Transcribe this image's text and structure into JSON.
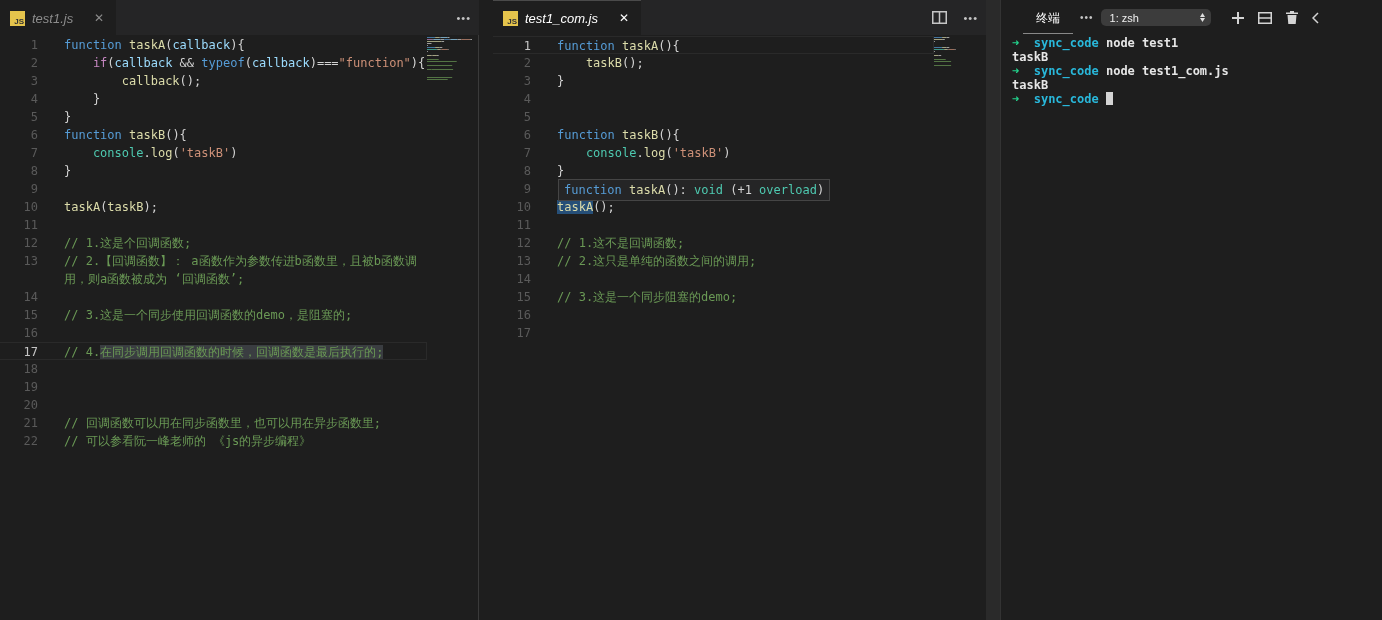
{
  "editors": [
    {
      "focused": false,
      "tab": {
        "icon_label": "JS",
        "title": "test1.js",
        "close": "✕"
      },
      "actions": [
        {
          "kind": "more",
          "label": "•••"
        }
      ],
      "lines": [
        {
          "number": "1",
          "current": false,
          "tokens": [
            {
              "kind": "kw",
              "text": "function "
            },
            {
              "kind": "fn",
              "text": "taskA"
            },
            {
              "kind": "plain",
              "text": "("
            },
            {
              "kind": "param",
              "text": "callback"
            },
            {
              "kind": "plain",
              "text": "){"
            }
          ]
        },
        {
          "number": "2",
          "current": false,
          "tokens": [
            {
              "kind": "ctrl",
              "text": "    if"
            },
            {
              "kind": "plain",
              "text": "("
            },
            {
              "kind": "param",
              "text": "callback"
            },
            {
              "kind": "plain",
              "text": " && "
            },
            {
              "kind": "kw",
              "text": "typeof"
            },
            {
              "kind": "plain",
              "text": "("
            },
            {
              "kind": "param",
              "text": "callback"
            },
            {
              "kind": "plain",
              "text": ")==="
            },
            {
              "kind": "str",
              "text": "\"function\""
            },
            {
              "kind": "plain",
              "text": "){"
            }
          ]
        },
        {
          "number": "3",
          "current": false,
          "tokens": [
            {
              "kind": "fn",
              "text": "        callback"
            },
            {
              "kind": "plain",
              "text": "();"
            }
          ]
        },
        {
          "number": "4",
          "current": false,
          "tokens": [
            {
              "kind": "plain",
              "text": "    }"
            }
          ]
        },
        {
          "number": "5",
          "current": false,
          "tokens": [
            {
              "kind": "plain",
              "text": "}"
            }
          ]
        },
        {
          "number": "6",
          "current": false,
          "tokens": [
            {
              "kind": "kw",
              "text": "function "
            },
            {
              "kind": "fn",
              "text": "taskB"
            },
            {
              "kind": "plain",
              "text": "(){"
            }
          ]
        },
        {
          "number": "7",
          "current": false,
          "tokens": [
            {
              "kind": "builtin",
              "text": "    console"
            },
            {
              "kind": "plain",
              "text": "."
            },
            {
              "kind": "fn",
              "text": "log"
            },
            {
              "kind": "plain",
              "text": "("
            },
            {
              "kind": "str",
              "text": "'taskB'"
            },
            {
              "kind": "plain",
              "text": ")"
            }
          ]
        },
        {
          "number": "8",
          "current": false,
          "tokens": [
            {
              "kind": "plain",
              "text": "}"
            }
          ]
        },
        {
          "number": "9",
          "current": false
        },
        {
          "number": "10",
          "current": false,
          "tokens": [
            {
              "kind": "fn",
              "text": "taskA"
            },
            {
              "kind": "plain",
              "text": "("
            },
            {
              "kind": "fn",
              "text": "taskB"
            },
            {
              "kind": "plain",
              "text": ");"
            }
          ]
        },
        {
          "number": "11",
          "current": false
        },
        {
          "number": "12",
          "current": false,
          "tokens": [
            {
              "kind": "comment",
              "text": "// 1.这是个回调函数;"
            }
          ]
        },
        {
          "number": "13",
          "current": false,
          "tokens": [
            {
              "kind": "comment",
              "text": "// 2.【回调函数】： a函数作为参数传进b函数里，且被b函数调"
            }
          ],
          "continuation": [
            {
              "kind": "comment",
              "text": "用，则a函数被成为 ‘回调函数’;"
            }
          ]
        },
        {
          "number": "14",
          "current": false
        },
        {
          "number": "15",
          "current": false,
          "tokens": [
            {
              "kind": "comment",
              "text": "// 3.这是一个同步使用回调函数的demo，是阻塞的;"
            }
          ]
        },
        {
          "number": "16",
          "current": false
        },
        {
          "number": "17",
          "current": true,
          "tokens": [
            {
              "kind": "comment",
              "text": "// 4."
            },
            {
              "kind": "comment-highlight",
              "text": "在同步调用回调函数的时候，回调函数是最后执行的;"
            }
          ]
        },
        {
          "number": "18",
          "current": false
        },
        {
          "number": "19",
          "current": false
        },
        {
          "number": "20",
          "current": false
        },
        {
          "number": "21",
          "current": false,
          "tokens": [
            {
              "kind": "comment",
              "text": "// 回调函数可以用在同步函数里，也可以用在异步函数里;"
            }
          ]
        },
        {
          "number": "22",
          "current": false,
          "tokens": [
            {
              "kind": "comment",
              "text": "// 可以参看阮一峰老师的 《js的异步编程》"
            }
          ]
        }
      ]
    },
    {
      "focused": true,
      "tab": {
        "icon_label": "JS",
        "title": "test1_com.js",
        "close": "✕"
      },
      "actions": [
        {
          "kind": "split"
        },
        {
          "kind": "more",
          "label": "•••"
        }
      ],
      "lines": [
        {
          "number": "1",
          "current": true,
          "tokens": [
            {
              "kind": "kw",
              "text": "function "
            },
            {
              "kind": "fn",
              "text": "taskA"
            },
            {
              "kind": "plain",
              "text": "(){"
            }
          ]
        },
        {
          "number": "2",
          "current": false,
          "tokens": [
            {
              "kind": "fn",
              "text": "    taskB"
            },
            {
              "kind": "plain",
              "text": "();"
            }
          ]
        },
        {
          "number": "3",
          "current": false,
          "tokens": [
            {
              "kind": "plain",
              "text": "}"
            }
          ]
        },
        {
          "number": "4",
          "current": false
        },
        {
          "number": "5",
          "current": false
        },
        {
          "number": "6",
          "current": false,
          "tokens": [
            {
              "kind": "kw",
              "text": "function "
            },
            {
              "kind": "fn",
              "text": "taskB"
            },
            {
              "kind": "plain",
              "text": "(){"
            }
          ]
        },
        {
          "number": "7",
          "current": false,
          "tokens": [
            {
              "kind": "builtin",
              "text": "    console"
            },
            {
              "kind": "plain",
              "text": "."
            },
            {
              "kind": "fn",
              "text": "log"
            },
            {
              "kind": "plain",
              "text": "("
            },
            {
              "kind": "str",
              "text": "'taskB'"
            },
            {
              "kind": "plain",
              "text": ")"
            }
          ]
        },
        {
          "number": "8",
          "current": false,
          "tokens": [
            {
              "kind": "plain",
              "text": "}"
            }
          ]
        },
        {
          "number": "9",
          "current": false,
          "tooltip": [
            {
              "kind": "kw",
              "text": "function "
            },
            {
              "kind": "fn",
              "text": "taskA"
            },
            {
              "kind": "plain",
              "text": "(): "
            },
            {
              "kind": "builtin",
              "text": "void"
            },
            {
              "kind": "plain",
              "text": " (+1 "
            },
            {
              "kind": "builtin",
              "text": "overload"
            },
            {
              "kind": "plain",
              "text": ")"
            }
          ]
        },
        {
          "number": "10",
          "current": false,
          "tokens": [
            {
              "kind": "fn-highlight",
              "text": "taskA"
            },
            {
              "kind": "plain",
              "text": "();"
            }
          ]
        },
        {
          "number": "11",
          "current": false
        },
        {
          "number": "12",
          "current": false,
          "tokens": [
            {
              "kind": "comment",
              "text": "// 1.这不是回调函数;"
            }
          ]
        },
        {
          "number": "13",
          "current": false,
          "tokens": [
            {
              "kind": "comment",
              "text": "// 2.这只是单纯的函数之间的调用;"
            }
          ]
        },
        {
          "number": "14",
          "current": false
        },
        {
          "number": "15",
          "current": false,
          "tokens": [
            {
              "kind": "comment",
              "text": "// 3.这是一个同步阻塞的demo;"
            }
          ]
        },
        {
          "number": "16",
          "current": false
        },
        {
          "number": "17",
          "current": false
        }
      ]
    }
  ],
  "terminal": {
    "tabs": [
      {
        "label": "终端",
        "selected": true
      }
    ],
    "more": "•••",
    "session": "1: zsh",
    "actions": [
      {
        "kind": "add"
      },
      {
        "kind": "split"
      },
      {
        "kind": "trash"
      },
      {
        "kind": "chevron"
      }
    ],
    "lines": [
      {
        "kind": "prompt",
        "arrow": "➜",
        "dir": "sync_code",
        "command": "node test1",
        "cursor": false
      },
      {
        "kind": "output",
        "text": "taskB"
      },
      {
        "kind": "prompt",
        "arrow": "➜",
        "dir": "sync_code",
        "command": "node test1_com.js",
        "cursor": false
      },
      {
        "kind": "output",
        "text": "taskB"
      },
      {
        "kind": "prompt",
        "arrow": "➜",
        "dir": "sync_code",
        "cursor": true
      }
    ]
  }
}
